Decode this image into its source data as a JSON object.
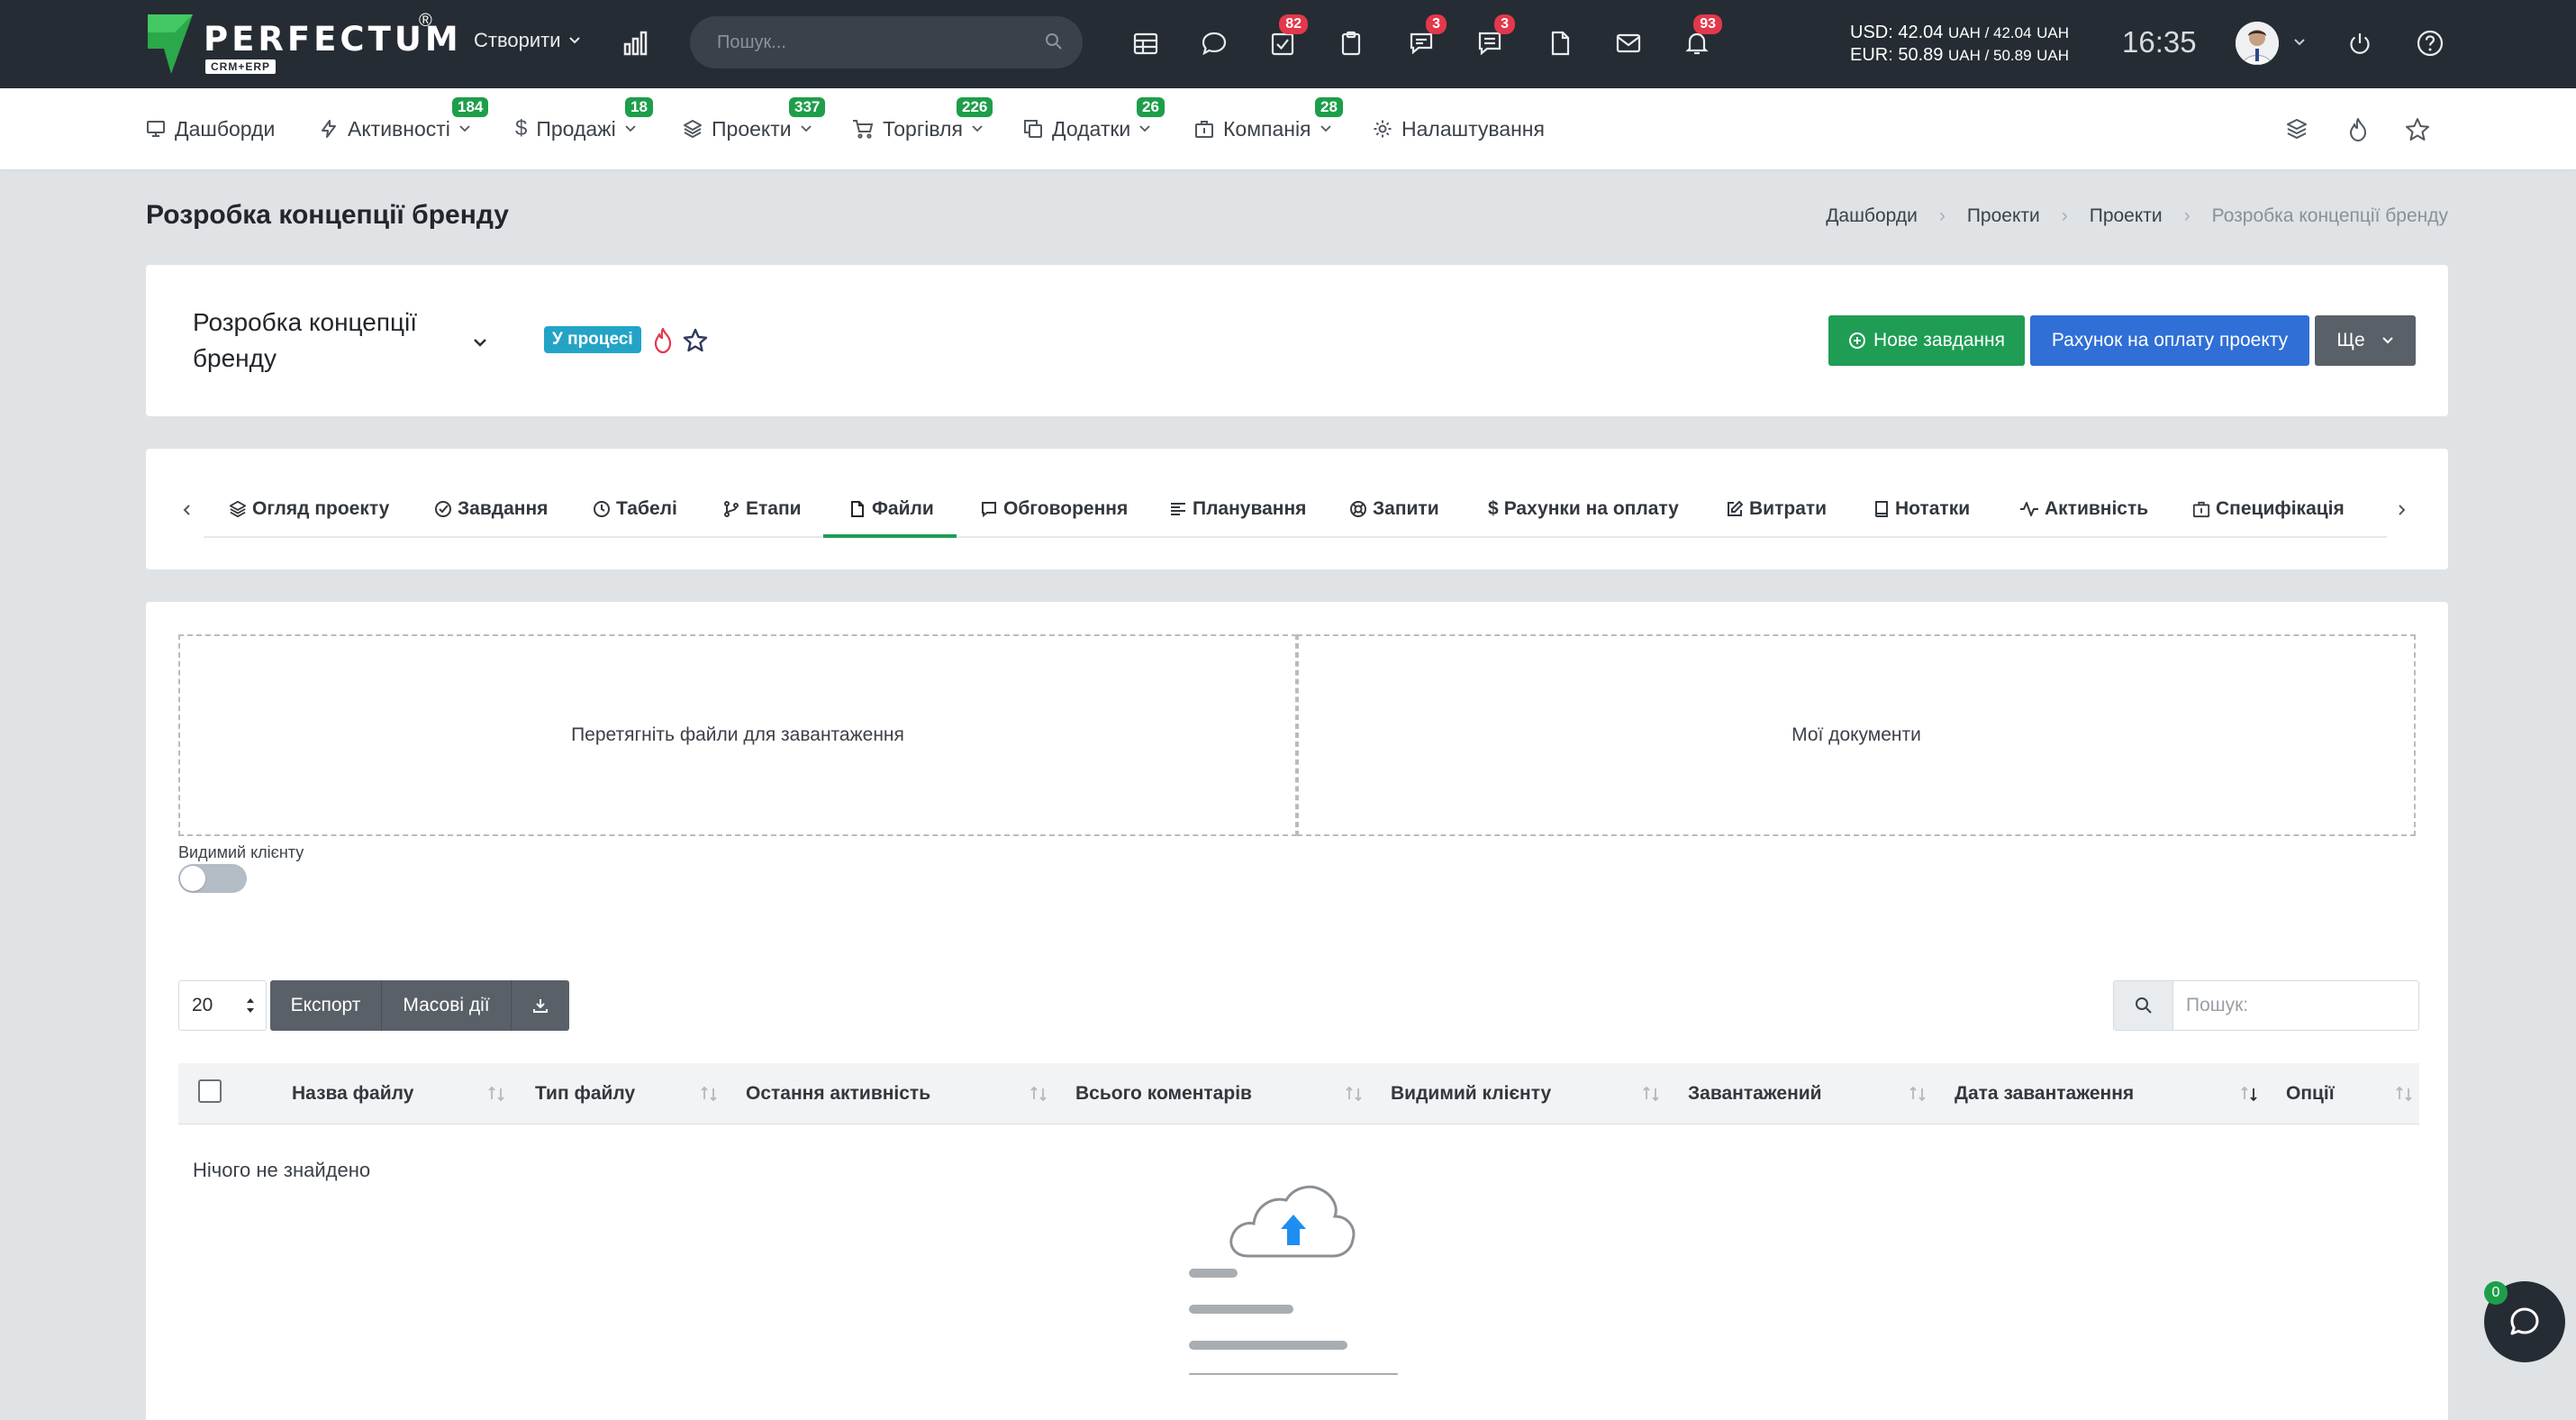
{
  "topbar": {
    "logo_text": "PERFECTUM",
    "logo_reg": "®",
    "logo_sub": "CRM+ERP",
    "create_label": "Створити",
    "search_placeholder": "Пошук...",
    "badges": {
      "tasks": "82",
      "chat": "3",
      "tickets": "3",
      "notifications": "93"
    },
    "currency_usd": "USD: 42.04",
    "currency_usd_rest": "UAH / 42.04",
    "currency_uah_unit": "UAH",
    "currency_eur": "EUR: 50.89",
    "currency_eur_rest": "UAH / 50.89",
    "time": "16:35"
  },
  "nav": {
    "items": [
      {
        "label": "Дашборди",
        "icon": "monitor-icon"
      },
      {
        "label": "Активності",
        "badge": "184",
        "icon": "bolt-icon"
      },
      {
        "label": "Продажі",
        "badge": "18",
        "icon": "dollar-icon"
      },
      {
        "label": "Проекти",
        "badge": "337",
        "icon": "layers-icon"
      },
      {
        "label": "Торгівля",
        "badge": "226",
        "icon": "cart-icon"
      },
      {
        "label": "Додатки",
        "badge": "26",
        "icon": "copy-icon"
      },
      {
        "label": "Компанія",
        "badge": "28",
        "icon": "briefcase-icon"
      },
      {
        "label": "Налаштування",
        "icon": "gear-icon"
      }
    ]
  },
  "page": {
    "title": "Розробка концепції бренду",
    "breadcrumb": [
      "Дашборди",
      "Проекти",
      "Проекти",
      "Розробка концепції бренду"
    ]
  },
  "project": {
    "name": "Розробка концепції бренду",
    "status": "У процесі",
    "new_task_label": "Нове завдання",
    "invoice_label": "Рахунок на оплату проекту",
    "more_label": "Ще"
  },
  "tabs": [
    {
      "label": "Огляд проекту",
      "icon": "layers-icon"
    },
    {
      "label": "Завдання",
      "icon": "check-circle-icon"
    },
    {
      "label": "Табелі",
      "icon": "clock-icon"
    },
    {
      "label": "Етапи",
      "icon": "branch-icon"
    },
    {
      "label": "Файли",
      "icon": "file-icon",
      "active": true
    },
    {
      "label": "Обговорення",
      "icon": "message-icon"
    },
    {
      "label": "Планування",
      "icon": "align-left-icon"
    },
    {
      "label": "Запити",
      "icon": "lifebuoy-icon"
    },
    {
      "label": "Рахунки на оплату",
      "icon": "dollar-icon"
    },
    {
      "label": "Витрати",
      "icon": "edit-icon"
    },
    {
      "label": "Нотатки",
      "icon": "book-icon"
    },
    {
      "label": "Активність",
      "icon": "activity-icon"
    },
    {
      "label": "Специфікація",
      "icon": "briefcase-icon"
    }
  ],
  "files": {
    "dropzone_upload": "Перетягніть файли для завантаження",
    "dropzone_docs": "Мої документи",
    "visible_to_client_label": "Видимий клієнту",
    "visible_to_client_on": false,
    "page_size": "20",
    "export_label": "Експорт",
    "bulk_label": "Масові дії",
    "search_placeholder": "Пошук:",
    "columns": [
      "Назва файлу",
      "Тип файлу",
      "Остання активність",
      "Всього коментарів",
      "Видимий клієнту",
      "Завантажений",
      "Дата завантаження",
      "Опції"
    ],
    "empty_text": "Нічого не знайдено"
  },
  "chat": {
    "count": "0"
  },
  "colors": {
    "accent_green": "#1f9d55",
    "primary_blue": "#2f6fd6",
    "status_cyan": "#23a4c7",
    "badge_red": "#e2384c",
    "dark": "#262c33"
  }
}
